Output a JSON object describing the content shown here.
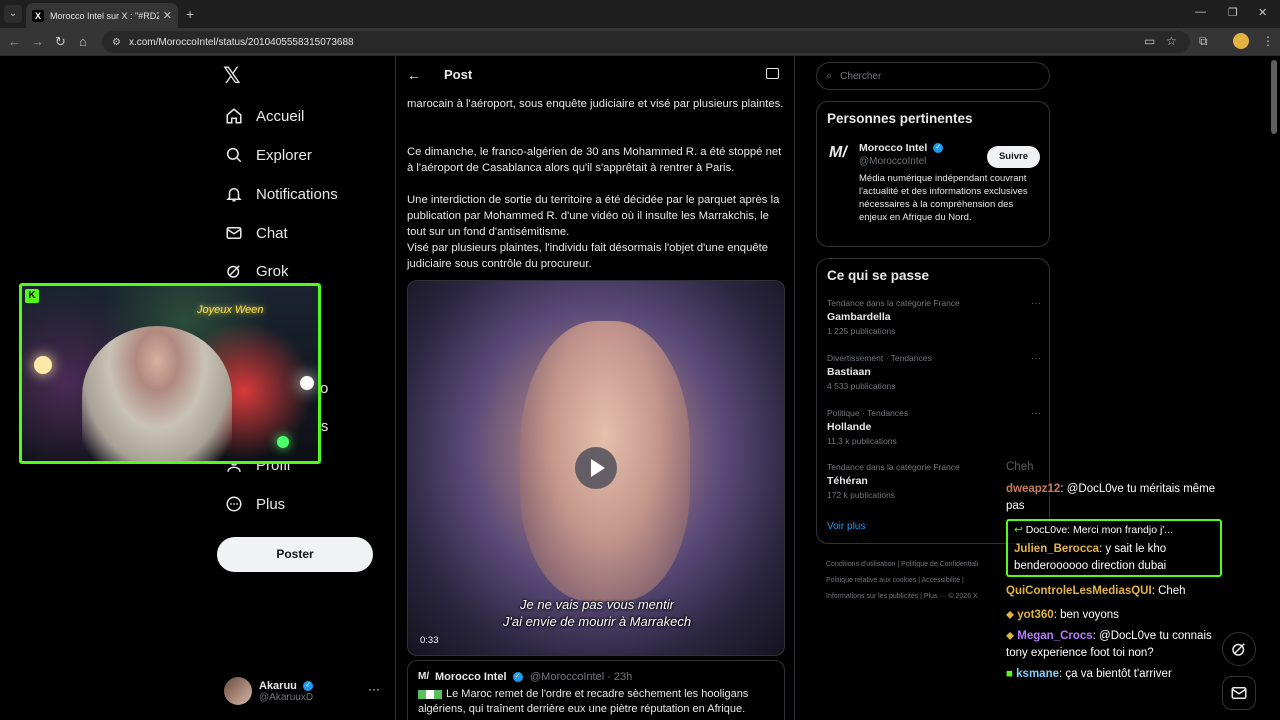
{
  "browser": {
    "tab_title": "Morocco Intel sur X : \"#RDZMA|",
    "tab_favicon": "X",
    "url": "x.com/MoroccoIntel/status/2010405558315073688"
  },
  "nav": {
    "items": [
      {
        "label": "Accueil",
        "icon": "home-icon"
      },
      {
        "label": "Explorer",
        "icon": "search-icon"
      },
      {
        "label": "Notifications",
        "icon": "bell-icon"
      },
      {
        "label": "Chat",
        "icon": "mail-icon"
      },
      {
        "label": "Grok",
        "icon": "grok-icon"
      },
      {
        "label": "udio",
        "icon": ""
      },
      {
        "label": "utés",
        "icon": ""
      },
      {
        "label": "Profil",
        "icon": "person-icon"
      },
      {
        "label": "Plus",
        "icon": "more-icon"
      }
    ],
    "post_button": "Poster",
    "account": {
      "name": "Akaruu",
      "handle": "@AkaruuxD"
    }
  },
  "post": {
    "header": "Post",
    "paragraphs": [
      "marocain à l'aéroport, sous enquête judiciaire et visé par plusieurs plaintes.",
      "Ce dimanche, le franco-algérien de 30 ans Mohammed R. a été stoppé net à l'aéroport de Casablanca alors qu'il s'apprêtait à rentrer à Paris.",
      "Une interdiction de sortie du territoire a été décidée par le parquet après la publication par Mohammed R. d'une vidéo où il insulte les Marrakchis, le tout sur un fond d'antisémitisme.",
      "Visé par plusieurs plaintes, l'individu fait désormais l'objet d'une enquête judiciaire sous contrôle du procureur."
    ],
    "video": {
      "subtitle_1": "Je ne vais pas vous mentir",
      "subtitle_2": "J'ai envie de mourir à Marrakech",
      "duration": "0:33"
    },
    "quoted": {
      "name": "Morocco Intel",
      "meta": "@MoroccoIntel · 23h",
      "text": "Le Maroc remet de l'ordre et recadre sèchement les hooligans algériens, qui traînent derrière eux une piètre réputation en Afrique."
    }
  },
  "sidebar": {
    "search_placeholder": "Chercher",
    "relevant": {
      "title": "Personnes pertinentes",
      "name": "Morocco Intel",
      "handle": "@MoroccoIntel",
      "follow": "Suivre",
      "bio": "Média numérique indépendant couvrant l'actualité et des informations exclusives nécessaires à la compréhension des enjeux en Afrique du Nord."
    },
    "trending": {
      "title": "Ce qui se passe",
      "items": [
        {
          "category": "Tendance dans la catégorie France",
          "name": "Gambardella",
          "count": "1 225 publications"
        },
        {
          "category": "Divertissement · Tendances",
          "name": "Bastiaan",
          "count": "4 533 publications"
        },
        {
          "category": "Politique · Tendances",
          "name": "Hollande",
          "count": "11,3 k publications"
        },
        {
          "category": "Tendance dans la catégorie France",
          "name": "Téhéran",
          "count": "172 k publications"
        }
      ],
      "show_more": "Voir plus"
    },
    "footer": {
      "line1": "Conditions d'utilisation  |  Politique de Confidentiali",
      "line2": "Politique relative aux cookies  |  Accessibilité  |",
      "line3": "Informations sur les publicités  |  Plus ···  © 2026 X"
    }
  },
  "stream": {
    "cam_sign": "Joyeux Ween"
  },
  "chat": {
    "messages": [
      {
        "user": "",
        "text": "Cheh"
      },
      {
        "user": "dweapz12",
        "text": ": @DocL0ve tu méritais même pas",
        "color": "#c77d5b"
      },
      {
        "reply": "DocL0ve: Merci mon frandjo j'...",
        "user": "Julien_Berocca",
        "text": ": y sait le kho benderoooooo direction dubai",
        "color": "#e3b341"
      },
      {
        "user": "QuiControleLesMediasQUI",
        "text": ": Cheh",
        "color": "#e3b341"
      },
      {
        "user": "yot360",
        "text": ": ben voyons",
        "color": "#e3b341"
      },
      {
        "user": "Megan_Crocs",
        "text": ": @DocL0ve tu connais tony experience foot toi non?",
        "color": "#b57bff"
      },
      {
        "user": "ksmane",
        "text": ": ça va bientôt t'arriver",
        "color": "#7ecfff"
      }
    ]
  }
}
